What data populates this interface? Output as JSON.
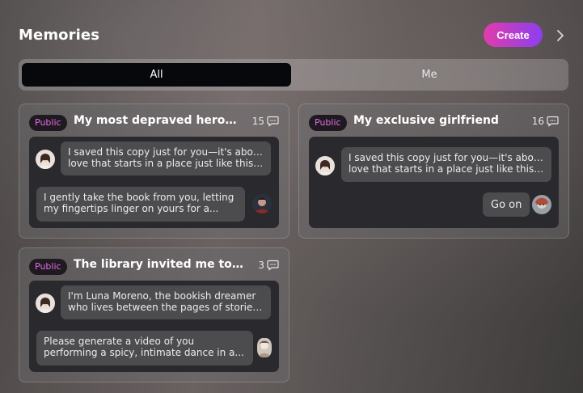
{
  "header": {
    "title": "Memories",
    "create_label": "Create"
  },
  "tabs": [
    {
      "label": "All",
      "active": true
    },
    {
      "label": "Me",
      "active": false
    }
  ],
  "colors": {
    "accent_start": "#e23cab",
    "accent_end": "#8b3ff0",
    "badge_text": "#e56ce0"
  },
  "cards": [
    {
      "badge": "Public",
      "title": "My most depraved heroine",
      "count": "15",
      "char_message": [
        "I saved this copy just for you—it's about a",
        "love that starts in a place just like this...."
      ],
      "user_message": [
        "I gently take the book from you, letting",
        "my fingertips linger on yours for a..."
      ]
    },
    {
      "badge": "Public",
      "title": "My exclusive girlfriend",
      "count": "16",
      "char_message": [
        "I saved this copy just for you—it's about a",
        "love that starts in a place just like this...."
      ],
      "user_message": [
        "Go on"
      ]
    },
    {
      "badge": "Public",
      "title": "The library invited me to da...",
      "count": "3",
      "char_message": [
        "I'm Luna Moreno, the bookish dreamer",
        "who lives between the pages of stories..."
      ],
      "user_message": [
        "Please generate a video of you",
        "performing a spicy, intimate dance in a..."
      ]
    }
  ]
}
